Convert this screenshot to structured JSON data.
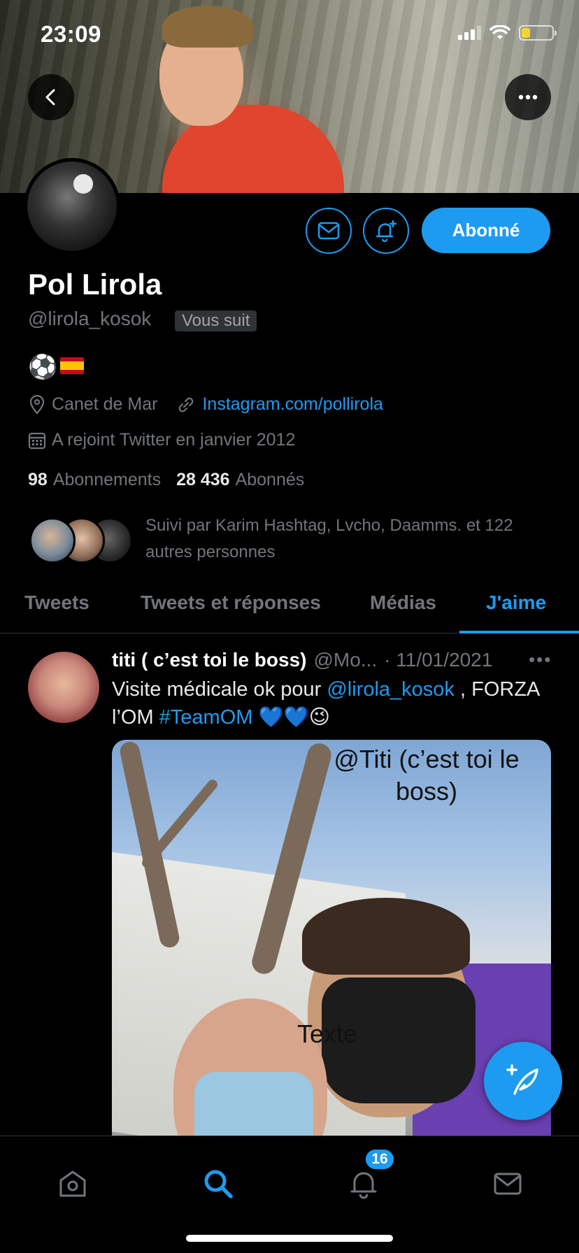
{
  "status_bar": {
    "time": "23:09",
    "battery_color": "#f5d431"
  },
  "header": {
    "back_icon": "chevron-left-icon",
    "more_icon": "more-horizontal-icon"
  },
  "profile": {
    "name": "Pol Lirola",
    "handle": "@lirola_kosok",
    "follows_you": "Vous suit",
    "bio": "⚽",
    "bio_flag": "Spain flag",
    "location": "Canet de Mar",
    "website": "Instagram.com/pollirola",
    "joined": "A rejoint Twitter en janvier 2012",
    "following_count": "98",
    "following_label": "Abonnements",
    "followers_count": "28 436",
    "followers_label": "Abonnés",
    "followed_by": "Suivi par Karim Hashtag, Lvcho, Daamms. et 122 autres personnes",
    "follow_button": "Abonné"
  },
  "tabs": [
    {
      "label": "Tweets",
      "active": false
    },
    {
      "label": "Tweets et réponses",
      "active": false
    },
    {
      "label": "Médias",
      "active": false
    },
    {
      "label": "J'aime",
      "active": true
    }
  ],
  "tweet": {
    "author": "titi ( c’est toi le boss)",
    "handle": "@Mo...",
    "date": "· 11/01/2021",
    "more": "•••",
    "text_1": "Visite médicale ok pour ",
    "mention": "@lirola_kosok",
    "text_2": " , FORZA l’OM ",
    "hashtag": "#TeamOM",
    "emojis": " 💙💙😉",
    "media_caption": "@Titi (c’est toi le boss)",
    "media_caption_2": "Texte"
  },
  "bottom_nav": {
    "items": [
      "home-icon",
      "search-icon",
      "bell-icon",
      "mail-icon"
    ],
    "active": "search-icon",
    "notifications_badge": "16"
  },
  "colors": {
    "accent": "#1d9bf0",
    "background": "#000000",
    "muted": "#71767b"
  }
}
